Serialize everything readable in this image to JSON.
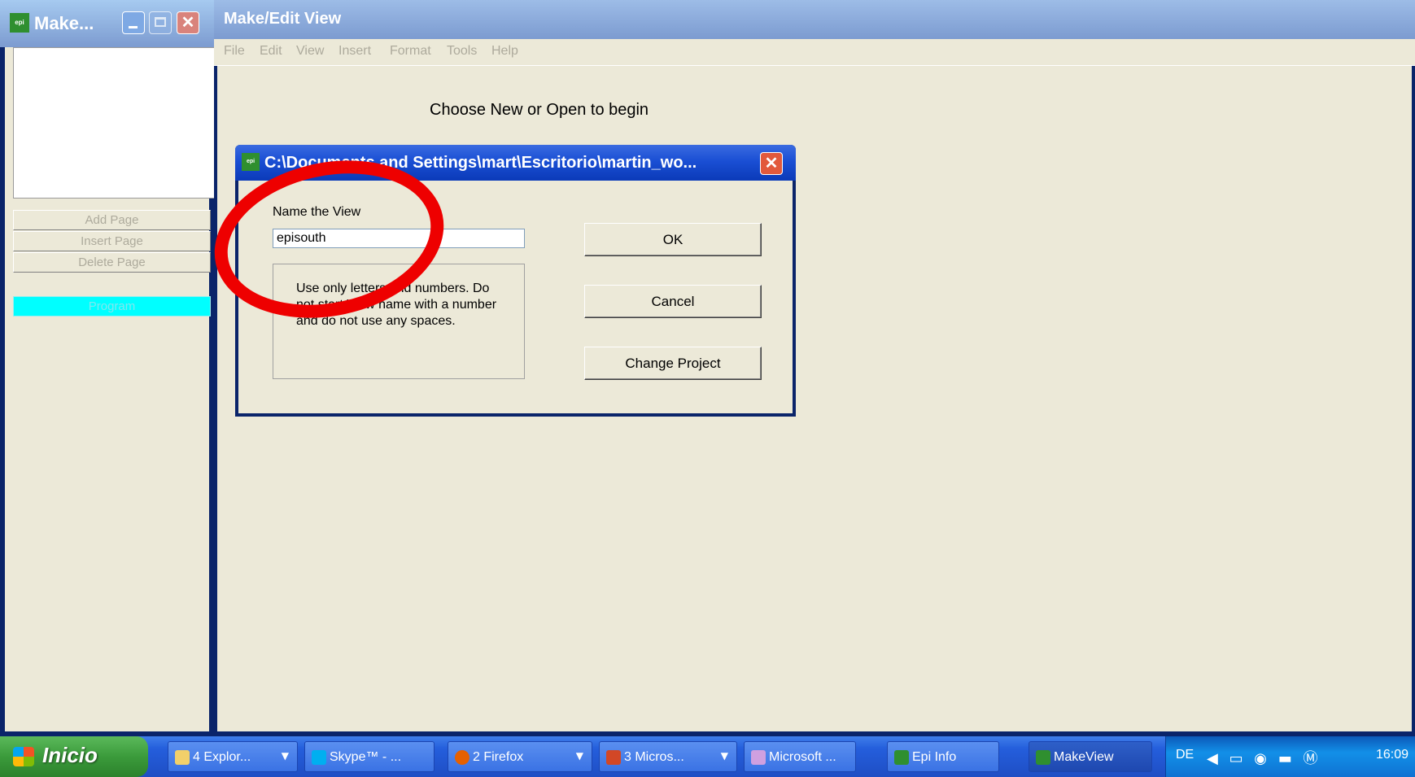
{
  "left_window": {
    "title": "Make...",
    "icon_label": "Epi Info",
    "buttons": {
      "add_page": "Add Page",
      "insert_page": "Insert Page",
      "delete_page": "Delete Page",
      "program": "Program"
    }
  },
  "main_window": {
    "title": "Make/Edit View",
    "menu": [
      "File",
      "Edit",
      "View",
      "Insert",
      "Format",
      "Tools",
      "Help"
    ],
    "prompt": "Choose New or Open to begin"
  },
  "dialog": {
    "title": "C:\\Documents and Settings\\mart\\Escritorio\\martin_wo...",
    "name_label": "Name the  View",
    "name_value": "episouth",
    "hint": "Use only letters and numbers. Do not start View name with a number and do not use any spaces.",
    "buttons": {
      "ok": "OK",
      "cancel": "Cancel",
      "change_project": "Change Project"
    }
  },
  "taskbar": {
    "start_label": "Inicio",
    "tasks": [
      {
        "label": "4 Explor...",
        "icon": "folder-icon",
        "color": "#F2D06A"
      },
      {
        "label": "Skype™ - ...",
        "icon": "skype-icon",
        "color": "#00AFF0"
      },
      {
        "label": "2 Firefox",
        "icon": "firefox-icon",
        "color": "#E66000"
      },
      {
        "label": "3 Micros...",
        "icon": "office-icon",
        "color": "#D24726"
      },
      {
        "label": "Microsoft ...",
        "icon": "document-icon",
        "color": "#D0A0E0"
      },
      {
        "label": "Epi Info",
        "icon": "epiinfo-icon",
        "color": "#2F8F2F"
      },
      {
        "label": "MakeView",
        "icon": "epiinfo-icon",
        "color": "#2F8F2F"
      }
    ],
    "tray": {
      "language": "DE",
      "time": "16:09"
    }
  },
  "colors": {
    "titlebar_active": "#0B3AB8",
    "annotation": "#EE0000",
    "program_button": "#00FFFF"
  }
}
